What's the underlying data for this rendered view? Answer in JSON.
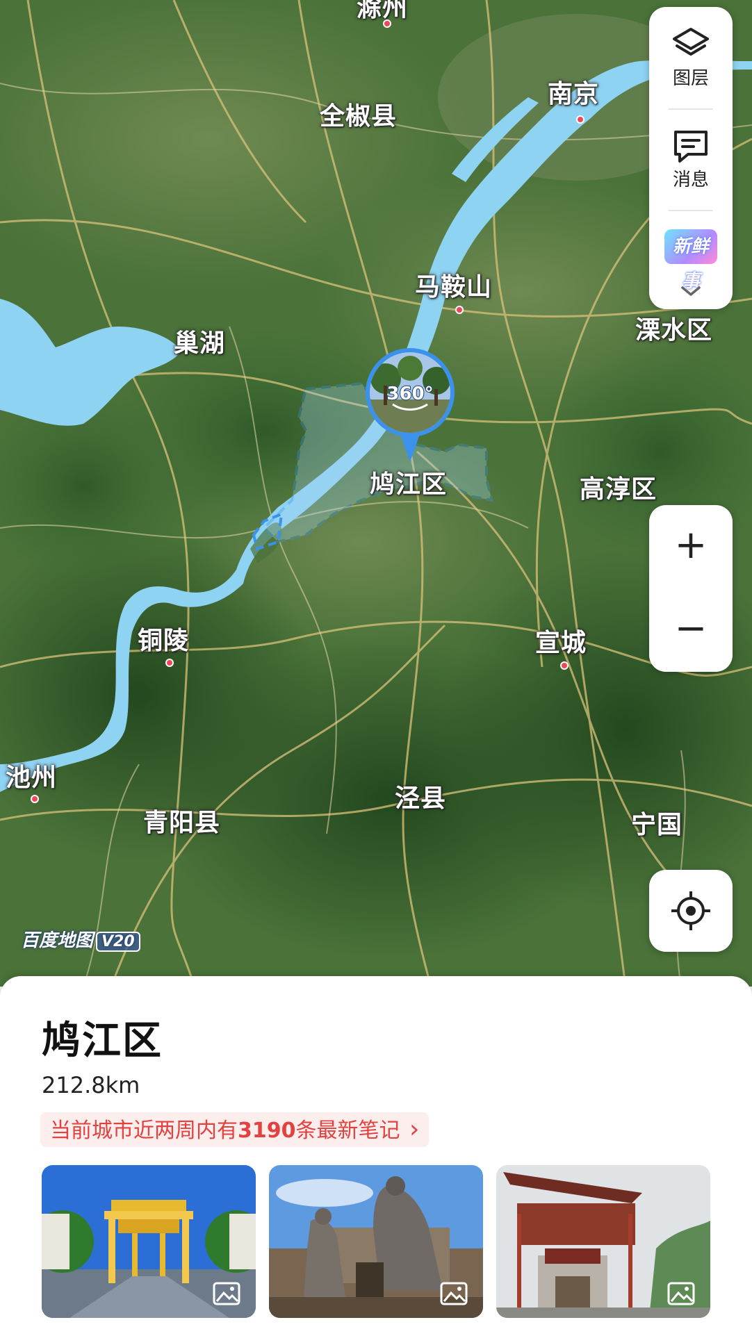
{
  "map": {
    "brand": "百度地图",
    "version": "V20",
    "panorama_badge": "360°",
    "cities": [
      {
        "name": "滁州",
        "dot": true
      },
      {
        "name": "全椒县",
        "dot": false
      },
      {
        "name": "南京",
        "dot": true
      },
      {
        "name": "马鞍山",
        "dot": true
      },
      {
        "name": "巢湖",
        "dot": false
      },
      {
        "name": "溧水区",
        "dot": false
      },
      {
        "name": "鸠江区",
        "dot": false
      },
      {
        "name": "高淳区",
        "dot": false
      },
      {
        "name": "铜陵",
        "dot": true
      },
      {
        "name": "宣城",
        "dot": true
      },
      {
        "name": "池州",
        "dot": true
      },
      {
        "name": "泾县",
        "dot": false
      },
      {
        "name": "青阳县",
        "dot": false
      },
      {
        "name": "宁国",
        "dot": false
      }
    ]
  },
  "toolbar": {
    "layers_label": "图层",
    "messages_label": "消息",
    "fresh_label": "新鲜事"
  },
  "zoom": {
    "in_symbol": "+",
    "out_symbol": "−"
  },
  "sheet": {
    "title": "鸠江区",
    "distance": "212.8km",
    "notes_prefix": "当前城市近两周内有",
    "notes_count": "3190",
    "notes_suffix": "条最新笔记",
    "notes_chevron": "›"
  },
  "colors": {
    "water": "#8fd3f2",
    "district_outline": "#3a92ea",
    "accent_red": "#e2413f",
    "terrain_green": "#3f6b35"
  }
}
